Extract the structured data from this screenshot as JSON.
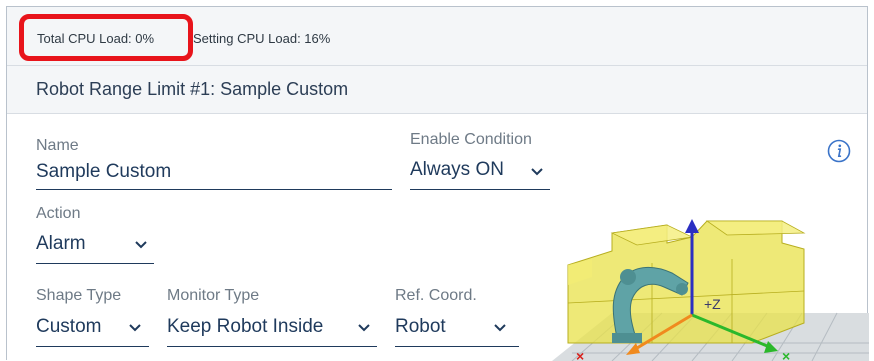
{
  "status": {
    "total_cpu": "Total CPU Load: 0%",
    "setting_cpu": "Setting CPU Load: 16%"
  },
  "panel": {
    "title": "Robot Range Limit #1: Sample Custom"
  },
  "form": {
    "name": {
      "label": "Name",
      "value": "Sample Custom"
    },
    "enable_condition": {
      "label": "Enable Condition",
      "value": "Always ON"
    },
    "action": {
      "label": "Action",
      "value": "Alarm"
    },
    "shape_type": {
      "label": "Shape Type",
      "value": "Custom"
    },
    "monitor_type": {
      "label": "Monitor Type",
      "value": "Keep Robot Inside"
    },
    "ref_coord": {
      "label": "Ref. Coord.",
      "value": "Robot"
    }
  },
  "icons": {
    "info": "info-icon",
    "dropdown": "chevron-down-icon"
  },
  "colors": {
    "highlight": "#e8141b",
    "text_primary": "#1f3a5c",
    "label": "#6e7a86",
    "info_blue": "#3a73c8"
  },
  "view3d": {
    "axis_label_z": "+Z"
  }
}
